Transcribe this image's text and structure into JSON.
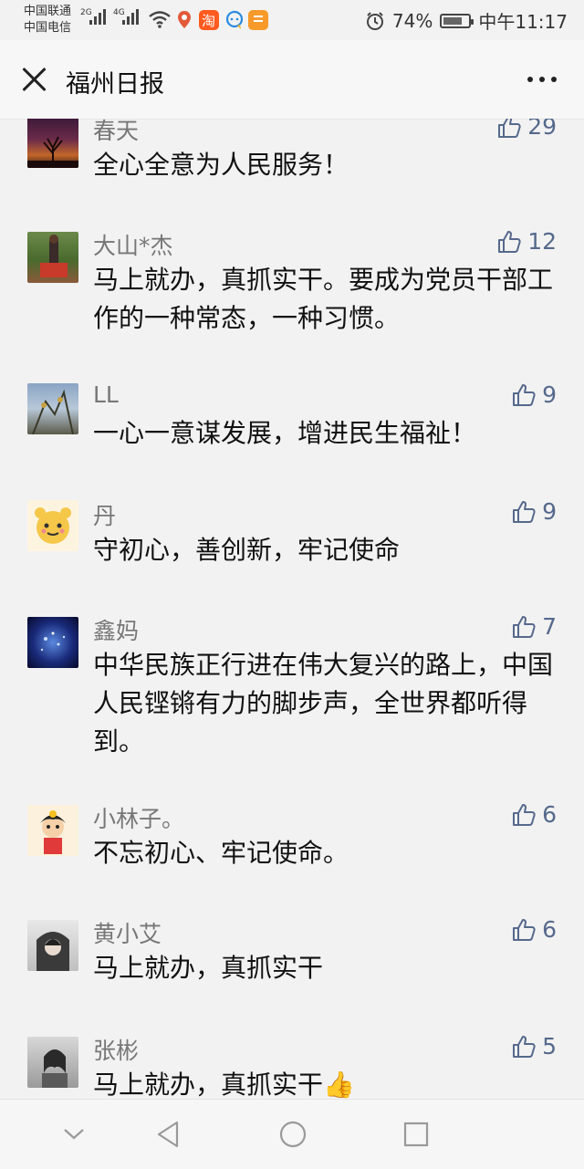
{
  "status": {
    "carrier1": "中国联通",
    "carrier2": "中国电信",
    "net1": "2G",
    "net2": "4G",
    "battery": "74%",
    "battery_level": 0.74,
    "time": "中午11:17"
  },
  "header": {
    "title": "福州日报"
  },
  "comments": [
    {
      "name": "春天",
      "text": "全心全意为人民服务！",
      "likes": "29"
    },
    {
      "name": "大山*杰",
      "text": "马上就办，真抓实干。要成为党员干部工作的一种常态，一种习惯。",
      "likes": "12"
    },
    {
      "name": "LL",
      "text": "一心一意谋发展，增进民生福祉！",
      "likes": "9"
    },
    {
      "name": "丹",
      "text": "守初心，善创新，牢记使命",
      "likes": "9"
    },
    {
      "name": "鑫妈",
      "text": "中华民族正行进在伟大复兴的路上，中国人民铿锵有力的脚步声，全世界都听得到。",
      "likes": "7"
    },
    {
      "name": "小林子。",
      "text": "不忘初心、牢记使命。",
      "likes": "6"
    },
    {
      "name": "黄小艾",
      "text": "马上就办，真抓实干",
      "likes": "6"
    },
    {
      "name": "张彬",
      "text": "马上就办，真抓实干👍",
      "likes": "5"
    }
  ],
  "colors": {
    "like": "#56698c",
    "name": "#777777",
    "background": "#f2f2f2"
  }
}
